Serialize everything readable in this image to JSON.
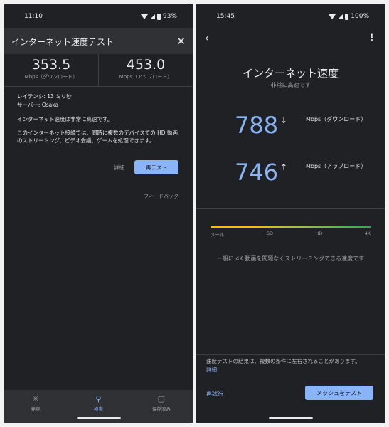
{
  "left": {
    "status": {
      "time": "11:10",
      "battery": "93%"
    },
    "header": {
      "title": "インターネット速度テスト",
      "close_icon": "close-icon"
    },
    "download": {
      "value": "353.5",
      "unit": "Mbps（ダウンロード）"
    },
    "upload": {
      "value": "453.0",
      "unit": "Mbps（アップロード）"
    },
    "info": {
      "latency": "レイテンシ: 13 ミリ秒",
      "server": "サーバー: Osaka",
      "summary": "インターネット速度は非常に高速です。",
      "body": "このインターネット接続では、同時に複数のデバイスでの HD 動画のストリーミング、ビデオ会議、ゲームを処理できます。"
    },
    "actions": {
      "detail": "詳細",
      "retest": "再テスト"
    },
    "feedback": "フィードバック",
    "nav": [
      {
        "icon": "✳",
        "label": "発見"
      },
      {
        "icon": "⚲",
        "label": "検索"
      },
      {
        "icon": "▢",
        "label": "保存済み"
      }
    ]
  },
  "right": {
    "status": {
      "time": "15:45",
      "battery": "100%"
    },
    "title": "インターネット速度",
    "subtitle": "非常に高速です",
    "download": {
      "value": "788",
      "arrow": "↓",
      "unit": "Mbps（ダウンロード）"
    },
    "upload": {
      "value": "746",
      "arrow": "↑",
      "unit": "Mbps（アップロード）"
    },
    "scale": [
      "メール",
      "SD",
      "HD",
      "4K"
    ],
    "note": "一般に 4K 動画を問題なくストリーミングできる速度です",
    "footnote": "速度テストの結果は、複数の条件に左右されることがあります。",
    "footnote_link": "詳細",
    "retry": "再試行",
    "mesh_test": "メッシュをテスト"
  },
  "colors": {
    "accent": "#8ab4f8",
    "background": "#202124",
    "surface": "#303134"
  }
}
